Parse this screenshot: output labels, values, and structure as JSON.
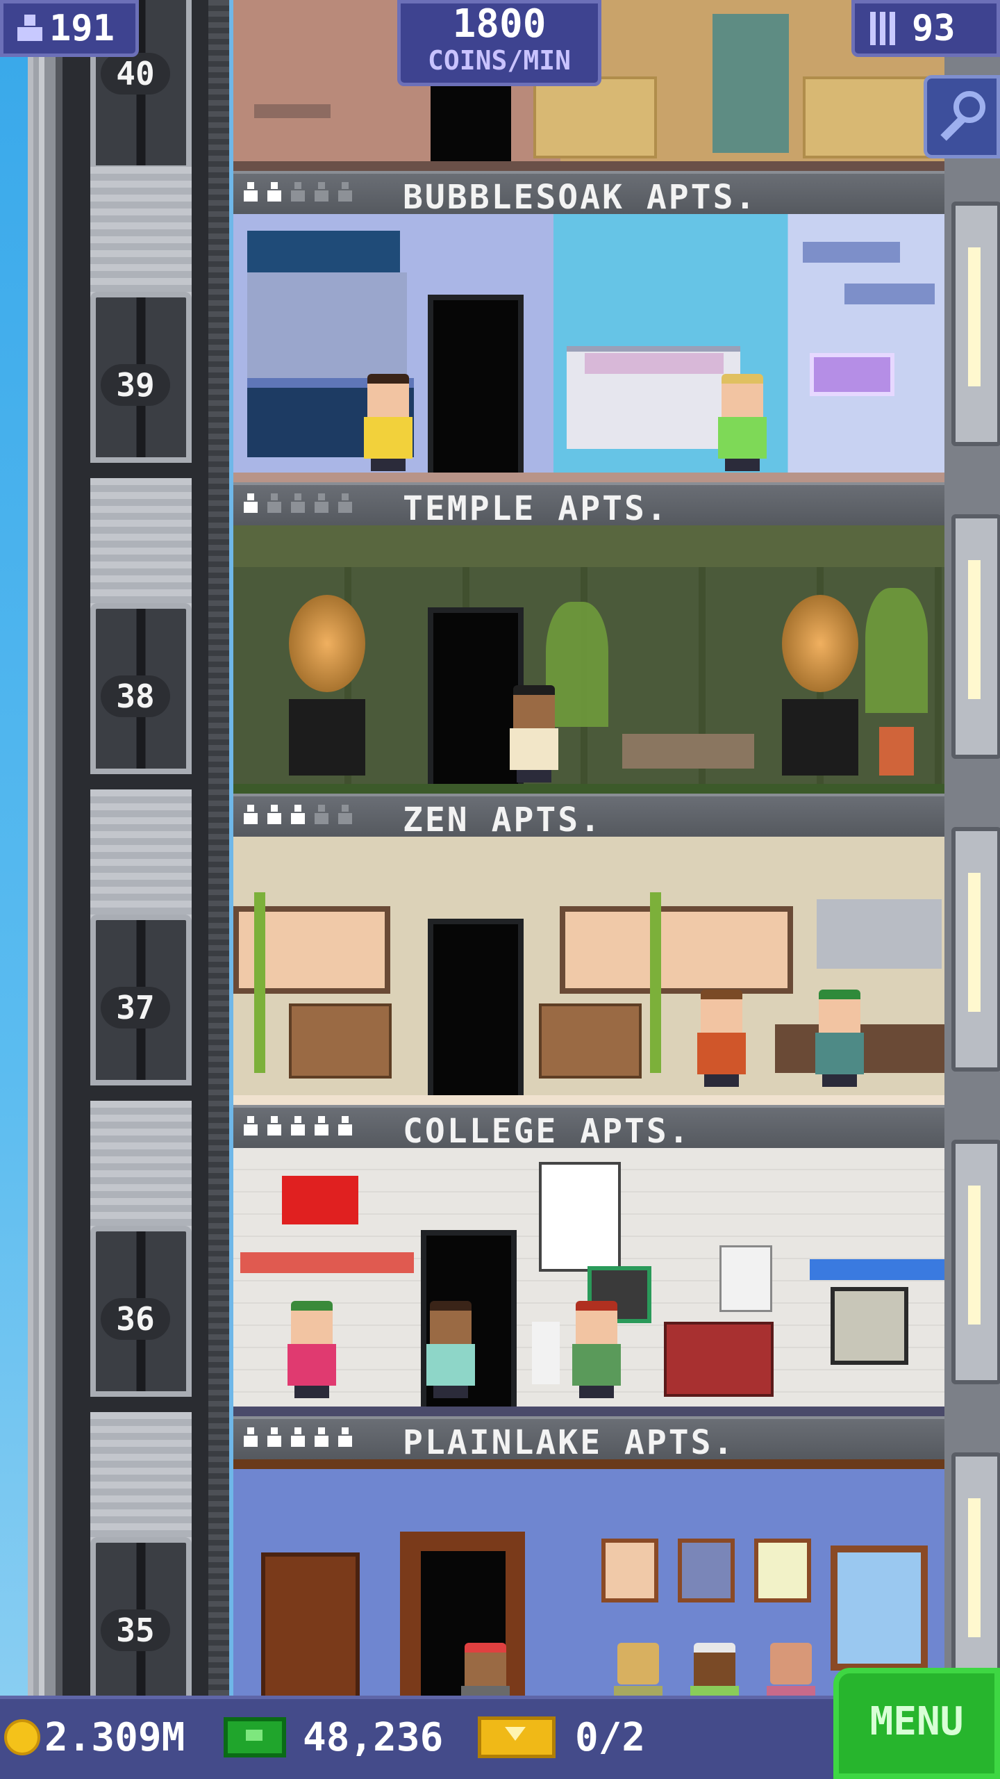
{
  "hud": {
    "population": "191",
    "coins_per_min": {
      "value": "1800",
      "unit": "COINS/MIN"
    },
    "floor_count": "93"
  },
  "floors": [
    {
      "name": "BUBBLESOAK APTS.",
      "number": "39",
      "occupied": 2,
      "capacity": 5
    },
    {
      "name": "TEMPLE APTS.",
      "number": "38",
      "occupied": 1,
      "capacity": 5
    },
    {
      "name": "ZEN APTS.",
      "number": "37",
      "occupied": 3,
      "capacity": 5
    },
    {
      "name": "COLLEGE APTS.",
      "number": "36",
      "occupied": 5,
      "capacity": 5
    },
    {
      "name": "PLAINLAKE APTS.",
      "number": "35",
      "occupied": 5,
      "capacity": 5
    }
  ],
  "top_floor_number": "40",
  "bottom_bar": {
    "coins": "2.309M",
    "bux": "48,236",
    "tickets": "0/2",
    "menu_label": "MENU"
  },
  "colors": {
    "hud_bg": "#3e4390",
    "menu_green": "#27b52d",
    "coin_gold": "#f4c21a"
  }
}
